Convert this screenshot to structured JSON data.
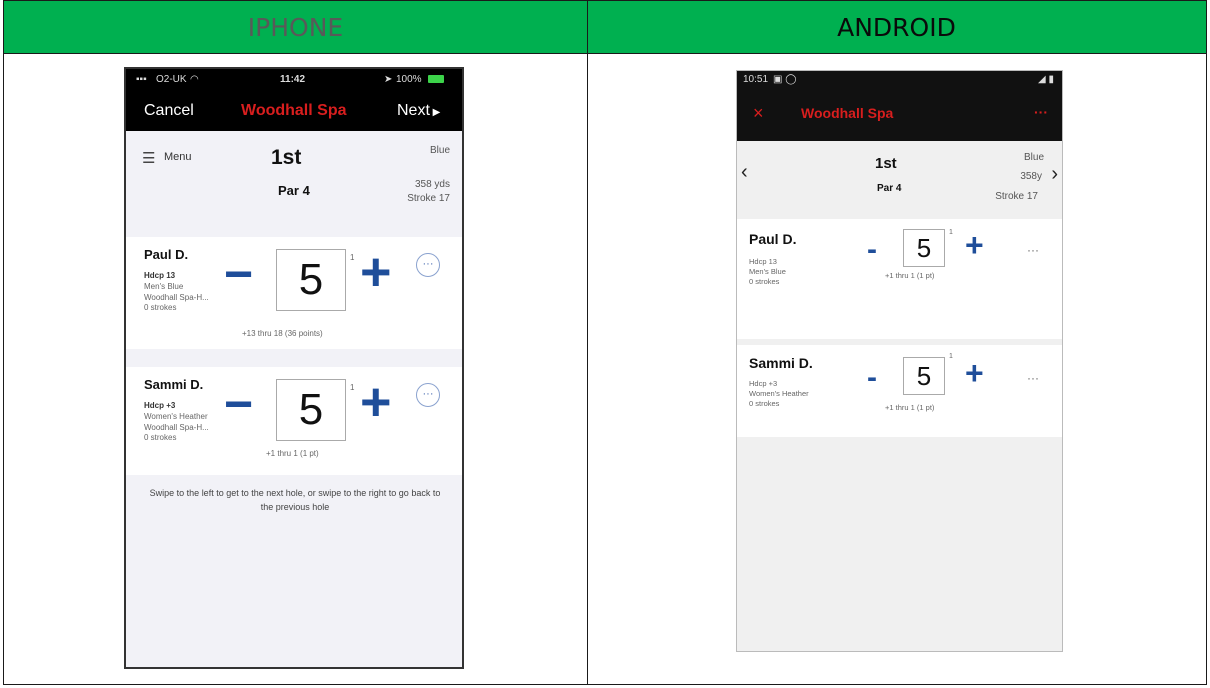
{
  "columns": {
    "left_header": "IPHONE",
    "right_header": "ANDROID"
  },
  "iphone": {
    "status": {
      "carrier": "O2-UK",
      "time": "11:42",
      "battery": "100%"
    },
    "nav": {
      "cancel": "Cancel",
      "title": "Woodhall Spa",
      "next": "Next"
    },
    "hole": {
      "menu": "Menu",
      "number": "1st",
      "tee": "Blue",
      "par": "Par 4",
      "yards": "358 yds",
      "stroke": "Stroke 17"
    },
    "players": [
      {
        "name": "Paul D.",
        "line1": "Hdcp 13",
        "line2": "Men's Blue",
        "line3": "Woodhall Spa-H...",
        "line4": "0 strokes",
        "score": "5",
        "sup": "1",
        "summary": "+13 thru 18 (36 points)"
      },
      {
        "name": "Sammi D.",
        "line1": "Hdcp +3",
        "line2": "Women's Heather",
        "line3": "Woodhall Spa-H...",
        "line4": "0 strokes",
        "score": "5",
        "sup": "1",
        "summary": "+1 thru 1 (1 pt)"
      }
    ],
    "hint": "Swipe to the left to get to the next hole, or swipe to the right to go back to the previous hole"
  },
  "android": {
    "status": {
      "time": "10:51"
    },
    "bar": {
      "close": "×",
      "title": "Woodhall Spa",
      "menu": "···"
    },
    "hole": {
      "number": "1st",
      "tee": "Blue",
      "par": "Par 4",
      "yards": "358y",
      "stroke": "Stroke 17"
    },
    "players": [
      {
        "name": "Paul D.",
        "line1": "Hdcp 13",
        "line2": "Men's Blue",
        "line3": "0 strokes",
        "score": "5",
        "sup": "1",
        "summary": "+1 thru 1 (1 pt)"
      },
      {
        "name": "Sammi D.",
        "line1": "Hdcp +3",
        "line2": "Women's Heather",
        "line3": "0 strokes",
        "score": "5",
        "sup": "1",
        "summary": "+1 thru 1 (1 pt)"
      }
    ]
  },
  "colors": {
    "header_green": "#00b050",
    "title_red": "#d81e1e",
    "control_blue": "#1f4e9a"
  }
}
